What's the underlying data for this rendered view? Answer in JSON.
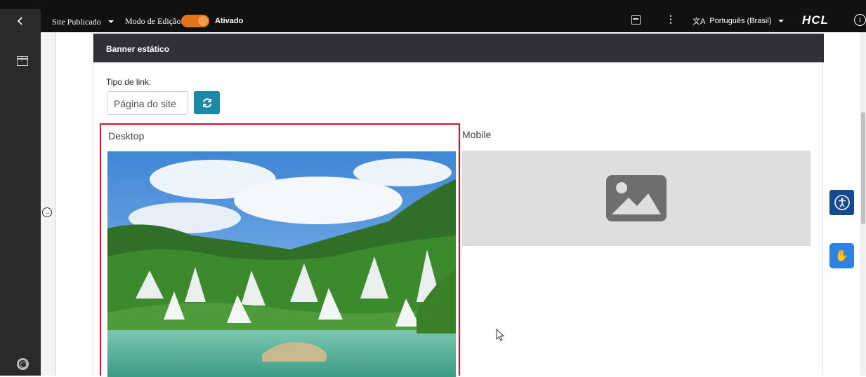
{
  "topbar": {
    "site_label": "Site Publicado",
    "mode_label": "Modo de Edição:",
    "mode_state": "Ativado",
    "language": "Português (Brasil)",
    "language_icon_text": "文A",
    "kebab": "⋮",
    "logo": "HCL",
    "info_icon_text": "i"
  },
  "gutter": {
    "expand_glyph": "→"
  },
  "card": {
    "title": "Banner estático",
    "link_type_label": "Tipo de link:",
    "link_type_value": "Página do site",
    "desktop_label": "Desktop",
    "mobile_label": "Mobile"
  },
  "widgets": {
    "libras_glyph": "✋"
  },
  "colors": {
    "topbar_bg": "#111111",
    "toggle_on": "#e1731c",
    "refresh_button": "#1a8aa6",
    "desktop_highlight": "#d4141d",
    "accessibility_button": "#144a8f",
    "libras_button": "#2c82e0"
  },
  "icons": {
    "back": "chevron-left-icon",
    "panel": "panel-icon",
    "add": "add-panel-icon",
    "help": "lifebuoy-icon",
    "refresh": "refresh-icon",
    "placeholder": "image-placeholder-icon",
    "accessibility": "accessibility-icon",
    "libras": "sign-language-icon"
  }
}
